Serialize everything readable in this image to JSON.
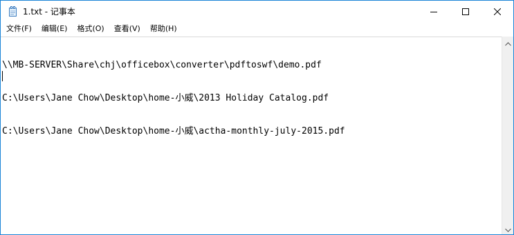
{
  "window": {
    "title": "1.txt - 记事本",
    "icon": "notepad-icon",
    "controls": {
      "minimize_icon": "minimize-icon",
      "maximize_icon": "maximize-icon",
      "close_icon": "close-icon"
    }
  },
  "menu": {
    "items": [
      {
        "label": "文件(F)"
      },
      {
        "label": "编辑(E)"
      },
      {
        "label": "格式(O)"
      },
      {
        "label": "查看(V)"
      },
      {
        "label": "帮助(H)"
      }
    ]
  },
  "editor": {
    "lines": [
      "\\\\MB-SERVER\\Share\\chj\\officebox\\converter\\pdftoswf\\demo.pdf",
      "C:\\Users\\Jane Chow\\Desktop\\home-小威\\2013 Holiday Catalog.pdf",
      "C:\\Users\\Jane Chow\\Desktop\\home-小威\\actha-monthly-july-2015.pdf"
    ]
  },
  "colors": {
    "window_border": "#1883d7",
    "scrollbar_bg": "#f0f0f0",
    "text": "#000000"
  }
}
